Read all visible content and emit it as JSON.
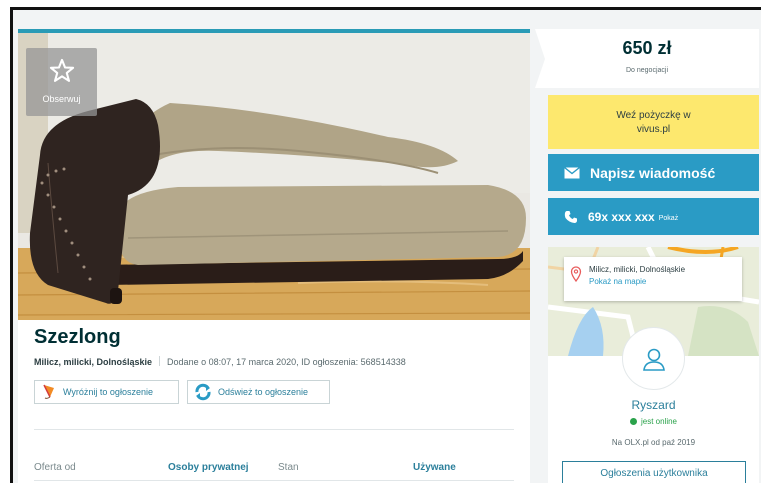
{
  "listing": {
    "watch_label": "Obserwuj",
    "title": "Szezlong",
    "location": "Milicz, milicki, Dolnośląskie",
    "added": "Dodane o 08:07, 17 marca 2020, ID ogłoszenia: 568514338",
    "feature_button": "Wyróżnij to ogłoszenie",
    "refresh_button": "Odśwież to ogłoszenie",
    "details": [
      {
        "label": "Oferta od",
        "value": "Osoby prywatnej"
      },
      {
        "label": "Stan",
        "value": "Używane"
      }
    ]
  },
  "sidebar": {
    "price": "650 zł",
    "price_note": "Do negocjacji",
    "loan_text_line1": "Weź pożyczkę w",
    "loan_text_line2": "vivus.pl",
    "message_button": "Napisz wiadomość",
    "phone": "69x xxx xxx",
    "phone_show": "Pokaż",
    "map_address": "Milicz, milicki, Dolnośląskie",
    "map_link": "Pokaż na mapie",
    "user_name": "Ryszard",
    "online_status": "jest online",
    "member_since": "Na OLX.pl od paź 2019",
    "user_ads_button": "Ogłoszenia użytkownika"
  },
  "colors": {
    "accent": "#2a9bc5",
    "loan_bg": "#fde86e",
    "online": "#2aa24b",
    "title": "#002f34"
  },
  "icons": [
    "star-icon",
    "kite-icon",
    "refresh-icon",
    "envelope-icon",
    "phone-icon",
    "map-pin-icon",
    "user-avatar-icon"
  ]
}
